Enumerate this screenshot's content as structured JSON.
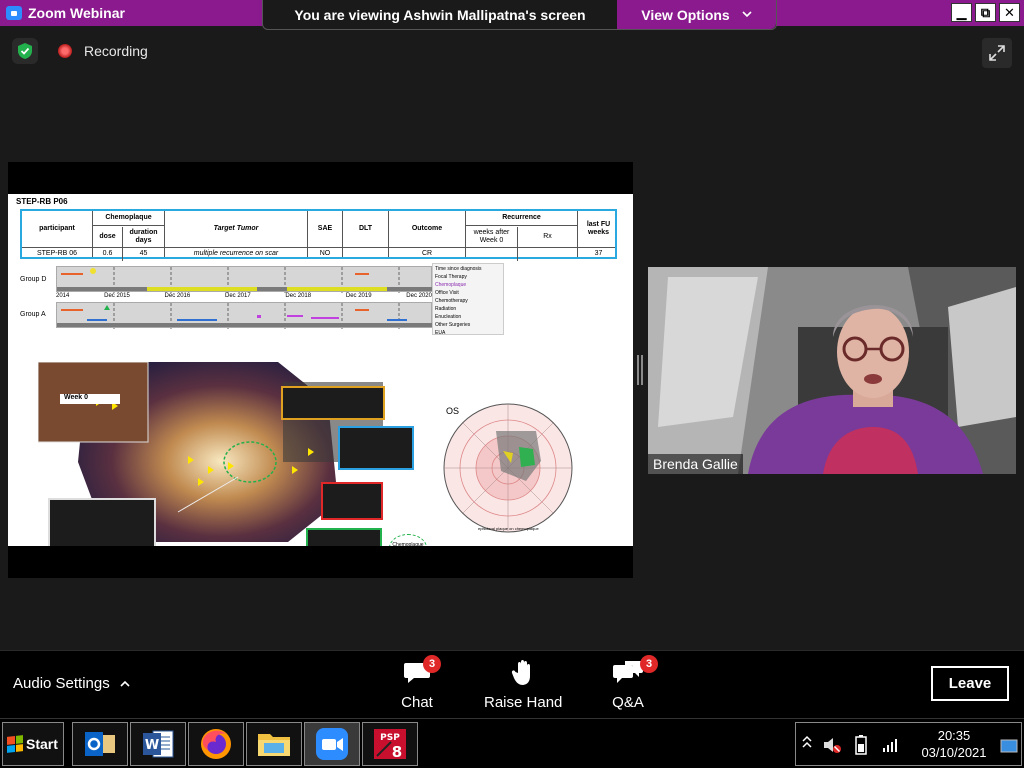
{
  "window": {
    "title": "Zoom Webinar",
    "share_banner": "You are viewing Ashwin Mallipatna's screen",
    "view_options": "View Options",
    "minimize": "▁",
    "restore": "⧉",
    "close": "✕"
  },
  "status": {
    "recording_label": "Recording"
  },
  "slide": {
    "title": "STEP-RB P06",
    "table": {
      "h_participant": "participant",
      "h_chemoplaque": "Chemoplaque",
      "h_dose": "dose",
      "h_duration": "duration days",
      "h_target": "Target Tumor",
      "h_sae": "SAE",
      "h_dlt": "DLT",
      "h_outcome": "Outcome",
      "h_recurrence": "Recurrence",
      "h_weeks_after": "weeks after Week 0",
      "h_rx": "Rx",
      "h_last_fu": "last FU weeks",
      "r_participant": "STEP-RB 06",
      "r_dose": "0.6",
      "r_duration": "45",
      "r_target": "multiple recurrence on scar",
      "r_sae": "NO",
      "r_dlt": "",
      "r_outcome": "CR",
      "r_weeks_after": "",
      "r_rx": "",
      "r_last_fu": "37"
    },
    "group_d": "Group D",
    "group_a": "Group A",
    "axis_ticks": [
      "2014",
      "Dec 2015",
      "Dec 2016",
      "Dec 2017",
      "Dec 2018",
      "Dec 2019",
      "Dec 2020"
    ],
    "legend": {
      "items": [
        "Time since diagnosis",
        "Focal Therapy",
        "Chemoplaque",
        "Office Visit",
        "Chemotherapy",
        "Radiation",
        "Enucleation",
        "Other Surgeries",
        "EUA"
      ]
    },
    "week0_label": "Week 0",
    "polar_label": "OS",
    "polar_caption": "episcleral plaque on chemoplaque",
    "chemoplaque_location": "Chemoplaque location"
  },
  "video": {
    "participant_name": "Brenda Gallie"
  },
  "controls": {
    "audio_settings": "Audio Settings",
    "chat_label": "Chat",
    "chat_badge": "3",
    "raise_hand_label": "Raise Hand",
    "qa_label": "Q&A",
    "qa_badge": "3",
    "leave_label": "Leave"
  },
  "taskbar": {
    "start_label": "Start",
    "time": "20:35",
    "date": "03/10/2021",
    "apps": [
      "outlook-icon",
      "word-icon",
      "firefox-icon",
      "file-explorer-icon",
      "zoom-icon",
      "psp-app-icon"
    ]
  }
}
